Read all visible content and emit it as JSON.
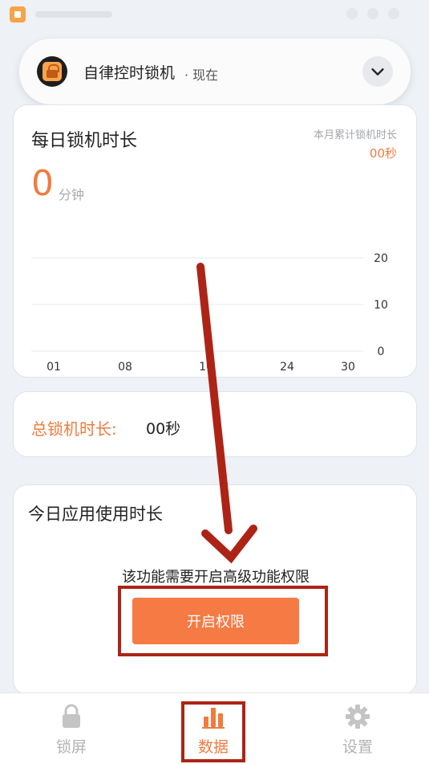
{
  "notification": {
    "app_name": "自律控时锁机",
    "time": "· 现在"
  },
  "daily": {
    "title": "每日锁机时长",
    "month_label": "本月累计锁机时长",
    "month_value": "00秒",
    "value": "0",
    "unit": "分钟"
  },
  "chart_data": {
    "type": "line",
    "x_ticks": [
      "01",
      "08",
      "16",
      "24",
      "30"
    ],
    "y_ticks": [
      "20",
      "10",
      "0"
    ],
    "ylim": [
      0,
      20
    ],
    "series": []
  },
  "total": {
    "label": "总锁机时长:",
    "value": "00秒"
  },
  "today": {
    "title": "今日应用使用时长",
    "message": "该功能需要开启高级功能权限",
    "button_label": "开启权限"
  },
  "nav": {
    "items": [
      {
        "label": "锁屏",
        "icon": "lock-icon"
      },
      {
        "label": "数据",
        "icon": "bar-chart-icon"
      },
      {
        "label": "设置",
        "icon": "gear-icon"
      }
    ],
    "active": 1
  },
  "colors": {
    "accent": "#f07b3e",
    "button": "#f57a44",
    "annotation": "#ad2416"
  }
}
